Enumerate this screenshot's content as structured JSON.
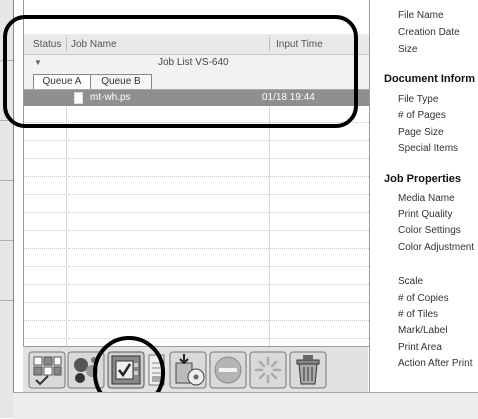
{
  "job_list": {
    "columns": {
      "status": "Status",
      "job_name": "Job Name",
      "input_time": "Input Time"
    },
    "title": "Job List VS-640",
    "tabs": [
      {
        "label": "Queue A"
      },
      {
        "label": "Queue B"
      }
    ],
    "selected_job": {
      "name": "mt-wh.ps",
      "time": "01/18 19:44"
    }
  },
  "toolbar": {
    "buttons": [
      {
        "icon": "queue-view-icon"
      },
      {
        "icon": "color-palette-icon"
      },
      {
        "icon": "printer-settings-icon"
      },
      {
        "icon": "document-icon"
      },
      {
        "icon": "save-disk-icon"
      },
      {
        "icon": "stop-icon"
      },
      {
        "icon": "spinner-icon"
      },
      {
        "icon": "trash-icon"
      }
    ]
  },
  "properties": {
    "file_items": [
      "File Name",
      "Creation Date",
      "Size"
    ],
    "document_section": "Document Inform",
    "document_items": [
      "File Type",
      "# of Pages",
      "Page Size",
      "Special Items"
    ],
    "job_section": "Job Properties",
    "job_items_a": [
      "Media Name",
      "Print Quality",
      "Color Settings",
      "Color Adjustment"
    ],
    "job_items_b": [
      "Scale",
      "# of Copies",
      "# of Tiles",
      "Mark/Label",
      "Print Area",
      "Action After Print"
    ]
  },
  "colors": {
    "selected_row": "#8f8f8f",
    "callout": "#000000"
  }
}
